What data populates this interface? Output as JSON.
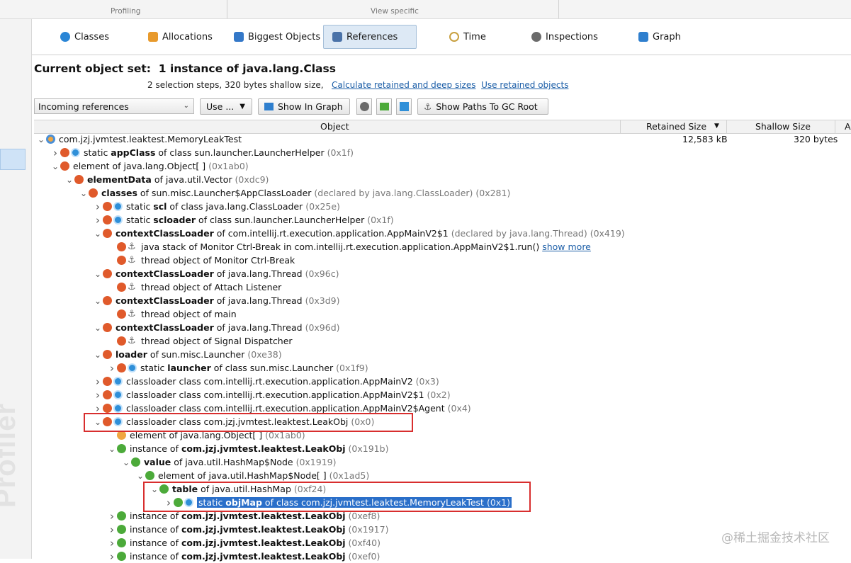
{
  "top_groups": {
    "profiling": "Profiling",
    "view_specific": "View specific"
  },
  "side_label": "Profiler",
  "tabs": [
    {
      "label": "Classes",
      "icon": "classes-icon",
      "color": "#2a86d6"
    },
    {
      "label": "Allocations",
      "icon": "allocations-icon",
      "color": "#e89a2c"
    },
    {
      "label": "Biggest Objects",
      "icon": "biggest-objects-icon",
      "color": "#3478c8"
    },
    {
      "label": "References",
      "icon": "references-icon",
      "color": "#4a72a8"
    },
    {
      "label": "Time",
      "icon": "clock-icon",
      "color": "#c8a040"
    },
    {
      "label": "Inspections",
      "icon": "gear-icon",
      "color": "#6b6b6b"
    },
    {
      "label": "Graph",
      "icon": "graph-icon",
      "color": "#2f7fce"
    }
  ],
  "header": {
    "title_prefix": "Current object set:",
    "title_value": "1 instance of java.lang.Class",
    "sub_text": "2 selection steps, 320 bytes shallow size,",
    "link1": "Calculate retained and deep sizes",
    "link2": "Use retained objects"
  },
  "toolbar": {
    "mode_select": "Incoming references",
    "use_button": "Use ...",
    "show_in_graph": "Show In Graph",
    "show_paths": "Show Paths To GC Root"
  },
  "columns": {
    "object": "Object",
    "retained": "Retained Size",
    "shallow": "Shallow Size",
    "extra": "A"
  },
  "rows": [
    {
      "toggle": "v",
      "icons": [
        "iobj"
      ],
      "pre": "",
      "bold": "",
      "post": "com.jzj.jvmtest.leaktest.MemoryLeakTest",
      "grey": "",
      "retained": "12,583 kB",
      "shallow": "320 bytes"
    },
    {
      "toggle": ">",
      "icons": [
        "red",
        "blue"
      ],
      "pre": "static ",
      "bold": "appClass",
      "post": " of class sun.launcher.LauncherHelper",
      "grey": " (0x1f)"
    },
    {
      "toggle": "v",
      "icons": [
        "red"
      ],
      "pre": "element of java.lang.Object[ ]",
      "bold": "",
      "post": "",
      "grey": " (0x1ab0)"
    },
    {
      "toggle": "v",
      "icons": [
        "red"
      ],
      "pre": "",
      "bold": "elementData",
      "post": " of java.util.Vector",
      "grey": " (0xdc9)"
    },
    {
      "toggle": "v",
      "icons": [
        "red"
      ],
      "pre": "",
      "bold": "classes",
      "post": " of sun.misc.Launcher$AppClassLoader",
      "grey": " (declared by java.lang.ClassLoader) (0x281)"
    },
    {
      "toggle": ">",
      "icons": [
        "red",
        "blue"
      ],
      "pre": "static ",
      "bold": "scl",
      "post": " of class java.lang.ClassLoader",
      "grey": " (0x25e)"
    },
    {
      "toggle": ">",
      "icons": [
        "red",
        "blue"
      ],
      "pre": "static ",
      "bold": "scloader",
      "post": " of class sun.launcher.LauncherHelper",
      "grey": " (0x1f)"
    },
    {
      "toggle": "v",
      "icons": [
        "red"
      ],
      "pre": "",
      "bold": "contextClassLoader",
      "post": " of com.intellij.rt.execution.application.AppMainV2$1",
      "grey": " (declared by java.lang.Thread) (0x419)"
    },
    {
      "toggle": "",
      "icons": [
        "red",
        "anchor"
      ],
      "pre": "java stack of Monitor Ctrl-Break in com.intellij.rt.execution.application.AppMainV2$1.run() ",
      "bold": "",
      "post": "",
      "grey": "",
      "link": "show more"
    },
    {
      "toggle": "",
      "icons": [
        "red",
        "anchor"
      ],
      "pre": "thread object of Monitor Ctrl-Break",
      "bold": "",
      "post": "",
      "grey": ""
    },
    {
      "toggle": "v",
      "icons": [
        "red"
      ],
      "pre": "",
      "bold": "contextClassLoader",
      "post": " of java.lang.Thread",
      "grey": " (0x96c)"
    },
    {
      "toggle": "",
      "icons": [
        "red",
        "anchor"
      ],
      "pre": "thread object of Attach Listener",
      "bold": "",
      "post": "",
      "grey": ""
    },
    {
      "toggle": "v",
      "icons": [
        "red"
      ],
      "pre": "",
      "bold": "contextClassLoader",
      "post": " of java.lang.Thread",
      "grey": " (0x3d9)"
    },
    {
      "toggle": "",
      "icons": [
        "red",
        "anchor"
      ],
      "pre": "thread object of main",
      "bold": "",
      "post": "",
      "grey": ""
    },
    {
      "toggle": "v",
      "icons": [
        "red"
      ],
      "pre": "",
      "bold": "contextClassLoader",
      "post": " of java.lang.Thread",
      "grey": " (0x96d)"
    },
    {
      "toggle": "",
      "icons": [
        "red",
        "anchor"
      ],
      "pre": "thread object of Signal Dispatcher",
      "bold": "",
      "post": "",
      "grey": ""
    },
    {
      "toggle": "v",
      "icons": [
        "red"
      ],
      "pre": "",
      "bold": "loader",
      "post": " of sun.misc.Launcher",
      "grey": " (0xe38)"
    },
    {
      "toggle": ">",
      "icons": [
        "red",
        "blue"
      ],
      "pre": "static ",
      "bold": "launcher",
      "post": " of class sun.misc.Launcher",
      "grey": " (0x1f9)"
    },
    {
      "toggle": ">",
      "icons": [
        "red",
        "blue"
      ],
      "pre": "classloader class com.intellij.rt.execution.application.AppMainV2",
      "bold": "",
      "post": "",
      "grey": " (0x3)"
    },
    {
      "toggle": ">",
      "icons": [
        "red",
        "blue"
      ],
      "pre": "classloader class com.intellij.rt.execution.application.AppMainV2$1",
      "bold": "",
      "post": "",
      "grey": " (0x2)"
    },
    {
      "toggle": ">",
      "icons": [
        "red",
        "blue"
      ],
      "pre": "classloader class com.intellij.rt.execution.application.AppMainV2$Agent",
      "bold": "",
      "post": "",
      "grey": " (0x4)"
    },
    {
      "toggle": "v",
      "icons": [
        "red",
        "blue"
      ],
      "pre": "classloader class com.jzj.jvmtest.leaktest.LeakObj",
      "bold": "",
      "post": "",
      "grey": " (0x0)"
    },
    {
      "toggle": "",
      "icons": [
        "orange"
      ],
      "pre": "element of java.lang.Object[ ]",
      "bold": "",
      "post": "",
      "grey": " (0x1ab0)"
    },
    {
      "toggle": "v",
      "icons": [
        "green"
      ],
      "pre": "instance of ",
      "bold": "com.jzj.jvmtest.leaktest.LeakObj",
      "post": "",
      "grey": " (0x191b)"
    },
    {
      "toggle": "v",
      "icons": [
        "green"
      ],
      "pre": "",
      "bold": "value",
      "post": " of java.util.HashMap$Node",
      "grey": " (0x1919)"
    },
    {
      "toggle": "v",
      "icons": [
        "green"
      ],
      "pre": "element of java.util.HashMap$Node[ ]",
      "bold": "",
      "post": "",
      "grey": " (0x1ad5)"
    },
    {
      "toggle": "v",
      "icons": [
        "green"
      ],
      "pre": "",
      "bold": "table",
      "post": " of java.util.HashMap",
      "grey": " (0xf24)"
    },
    {
      "toggle": ">",
      "icons": [
        "green",
        "blue"
      ],
      "pre": "static ",
      "bold": "objMap",
      "post": " of class com.jzj.jvmtest.leaktest.MemoryLeakTest",
      "grey": " (0x1)",
      "selected": true
    },
    {
      "toggle": ">",
      "icons": [
        "green"
      ],
      "pre": "instance of ",
      "bold": "com.jzj.jvmtest.leaktest.LeakObj",
      "post": "",
      "grey": " (0xef8)"
    },
    {
      "toggle": ">",
      "icons": [
        "green"
      ],
      "pre": "instance of ",
      "bold": "com.jzj.jvmtest.leaktest.LeakObj",
      "post": "",
      "grey": " (0x1917)"
    },
    {
      "toggle": ">",
      "icons": [
        "green"
      ],
      "pre": "instance of ",
      "bold": "com.jzj.jvmtest.leaktest.LeakObj",
      "post": "",
      "grey": " (0xf40)"
    },
    {
      "toggle": ">",
      "icons": [
        "green"
      ],
      "pre": "instance of ",
      "bold": "com.jzj.jvmtest.leaktest.LeakObj",
      "post": "",
      "grey": " (0xef0)"
    }
  ],
  "watermark": "@稀土掘金技术社区"
}
